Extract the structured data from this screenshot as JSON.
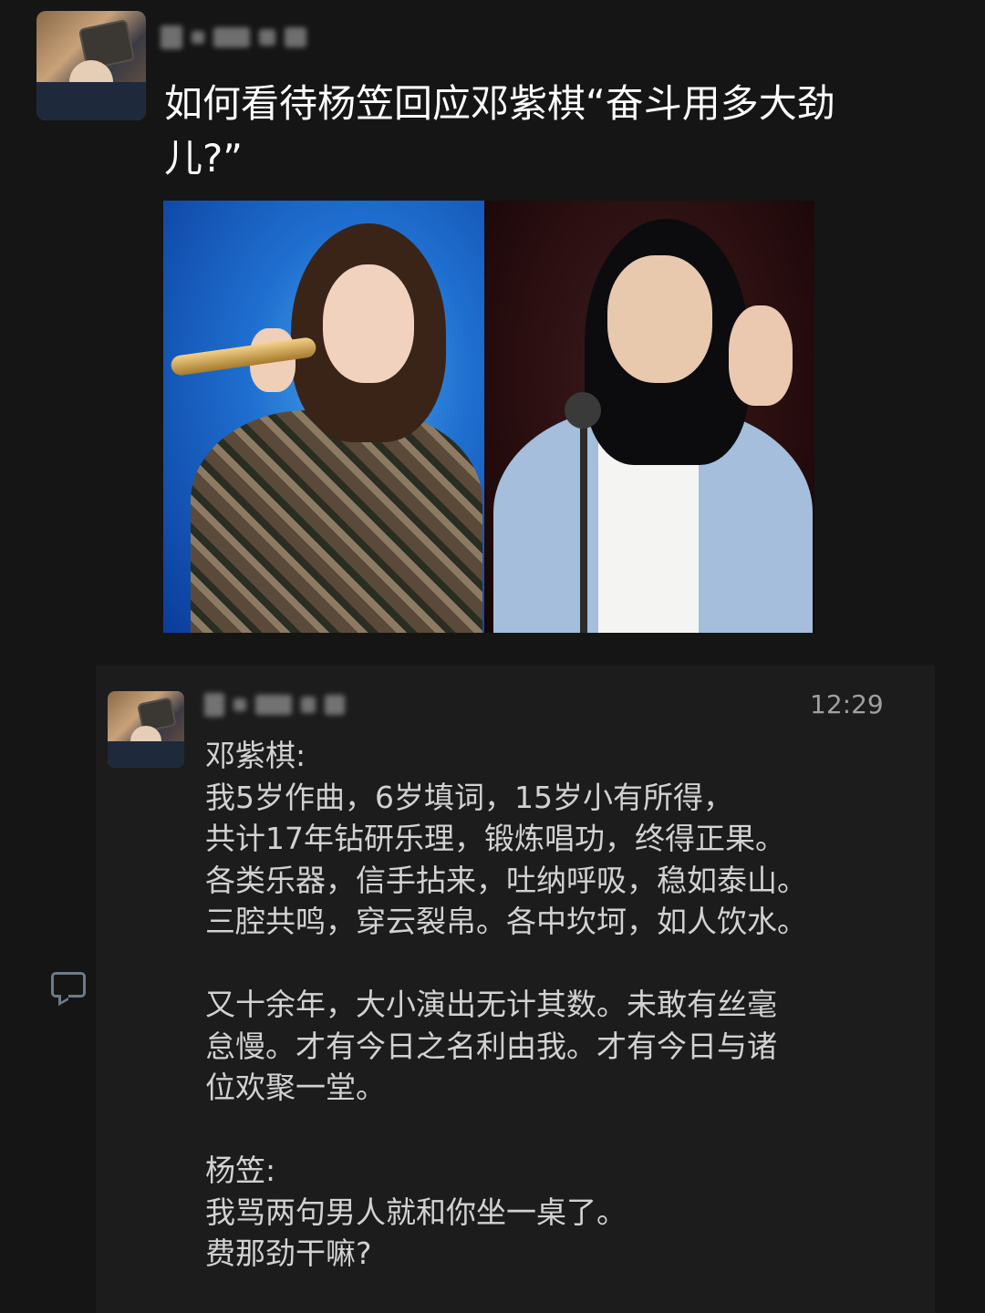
{
  "post": {
    "title": "如何看待杨笠回应邓紫棋“奋斗用多大劲儿?”",
    "icons": [
      "avatar",
      "photo-deng-ziqi-singing",
      "photo-yang-li-speaking"
    ]
  },
  "reply": {
    "time": "12:29",
    "lines": [
      "邓紫棋:",
      "我5岁作曲，6岁填词，15岁小有所得，",
      "共计17年钻研乐理，锻炼唱功，终得正果。",
      "各类乐器，信手拈来，吐纳呼吸，稳如泰山。",
      "三腔共鸣，穿云裂帛。各中坎坷，如人饮水。",
      "",
      "又十余年，大小演出无计其数。未敢有丝毫",
      "怠慢。才有今日之名利由我。才有今日与诸",
      "位欢聚一堂。",
      "",
      "杨笠:",
      "我骂两句男人就和你坐一桌了。",
      "费那劲干嘛?"
    ]
  },
  "side": {
    "icon": "comment-icon"
  }
}
